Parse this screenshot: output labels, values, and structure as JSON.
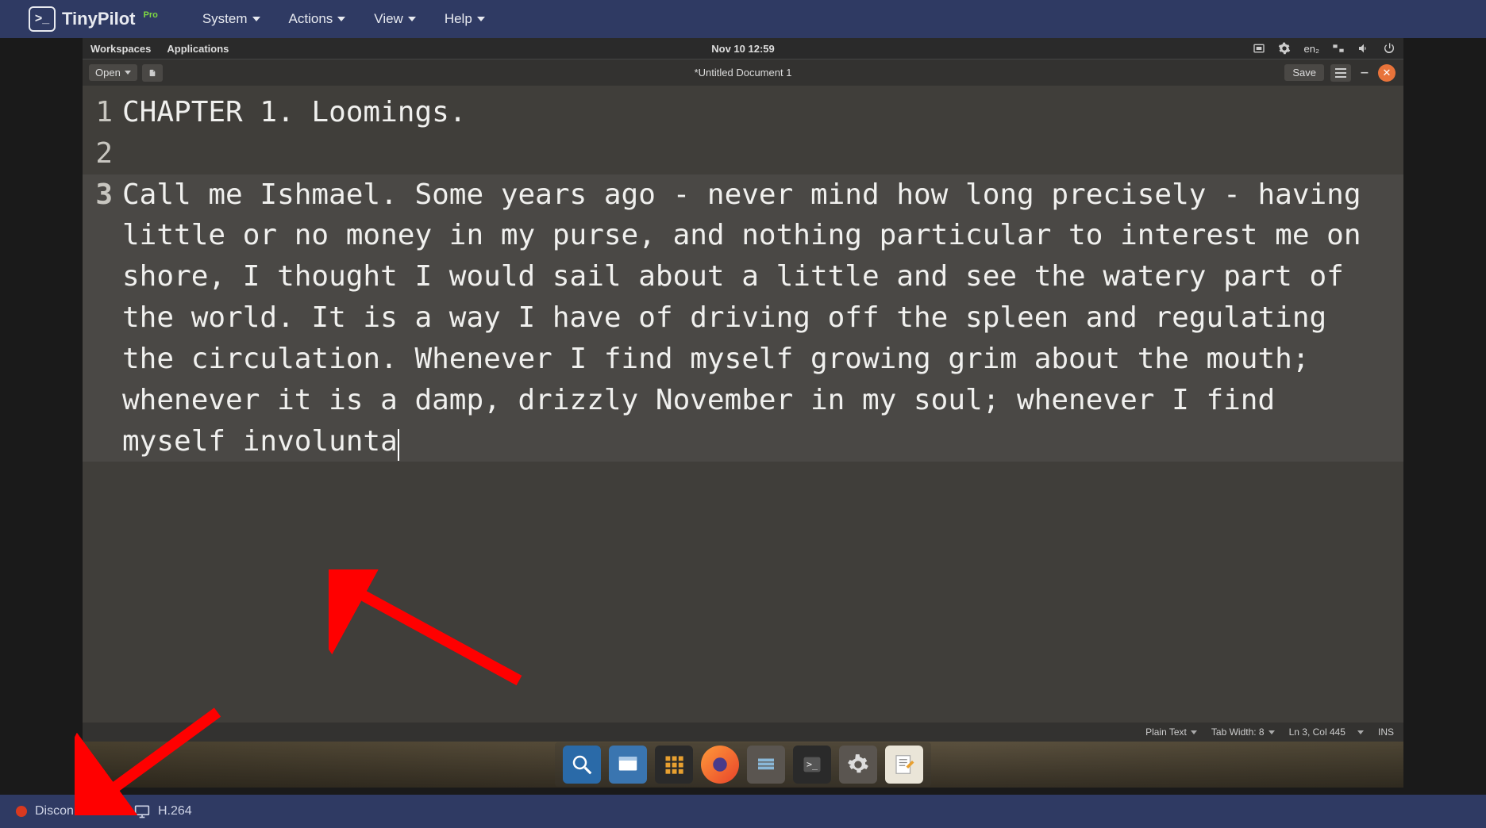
{
  "tinypilot": {
    "brand": "TinyPilot",
    "pro": "Pro",
    "menus": {
      "system": "System",
      "actions": "Actions",
      "view": "View",
      "help": "Help"
    },
    "status": {
      "connection": "Disconnected",
      "codec": "H.264"
    }
  },
  "gnome": {
    "workspaces": "Workspaces",
    "applications": "Applications",
    "datetime": "Nov 10  12:59",
    "lang": "en₂"
  },
  "editor": {
    "open_label": "Open",
    "title": "*Untitled Document 1",
    "save_label": "Save",
    "lines": {
      "l1_num": "1",
      "l1_text": "CHAPTER 1. Loomings.",
      "l2_num": "2",
      "l2_text": "",
      "l3_num": "3",
      "l3_text": "Call me Ishmael. Some years ago - never mind how long precisely - having little or no money in my purse, and nothing particular to interest me on shore, I thought I would sail about a little and see the watery part of the world. It is a way I have of driving off the spleen and regulating the circulation. Whenever I find myself growing grim about the mouth; whenever it is a damp, drizzly November in my soul; whenever I find myself involunta"
    },
    "status": {
      "syntax": "Plain Text",
      "tab_width": "Tab Width: 8",
      "position": "Ln 3, Col 445",
      "mode": "INS"
    }
  }
}
